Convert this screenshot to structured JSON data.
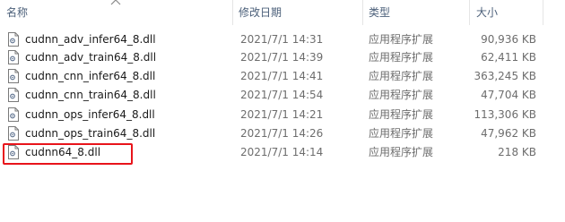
{
  "columns": {
    "name": "名称",
    "date": "修改日期",
    "type": "类型",
    "size": "大小"
  },
  "files": [
    {
      "name": "cudnn_adv_infer64_8.dll",
      "date": "2021/7/1 14:31",
      "type": "应用程序扩展",
      "size": "90,936 KB"
    },
    {
      "name": "cudnn_adv_train64_8.dll",
      "date": "2021/7/1 14:39",
      "type": "应用程序扩展",
      "size": "62,411 KB"
    },
    {
      "name": "cudnn_cnn_infer64_8.dll",
      "date": "2021/7/1 14:41",
      "type": "应用程序扩展",
      "size": "363,245 KB"
    },
    {
      "name": "cudnn_cnn_train64_8.dll",
      "date": "2021/7/1 14:54",
      "type": "应用程序扩展",
      "size": "47,704 KB"
    },
    {
      "name": "cudnn_ops_infer64_8.dll",
      "date": "2021/7/1 14:21",
      "type": "应用程序扩展",
      "size": "113,306 KB"
    },
    {
      "name": "cudnn_ops_train64_8.dll",
      "date": "2021/7/1 14:26",
      "type": "应用程序扩展",
      "size": "47,962 KB"
    },
    {
      "name": "cudnn64_8.dll",
      "date": "2021/7/1 14:14",
      "type": "应用程序扩展",
      "size": "218 KB"
    }
  ],
  "icons": {
    "file": "dll-file-icon",
    "sort": "sort-ascending-icon"
  },
  "colors": {
    "highlight": "#e8141b",
    "header_text": "#4c607a",
    "secondary_text": "#6d6d6d"
  }
}
